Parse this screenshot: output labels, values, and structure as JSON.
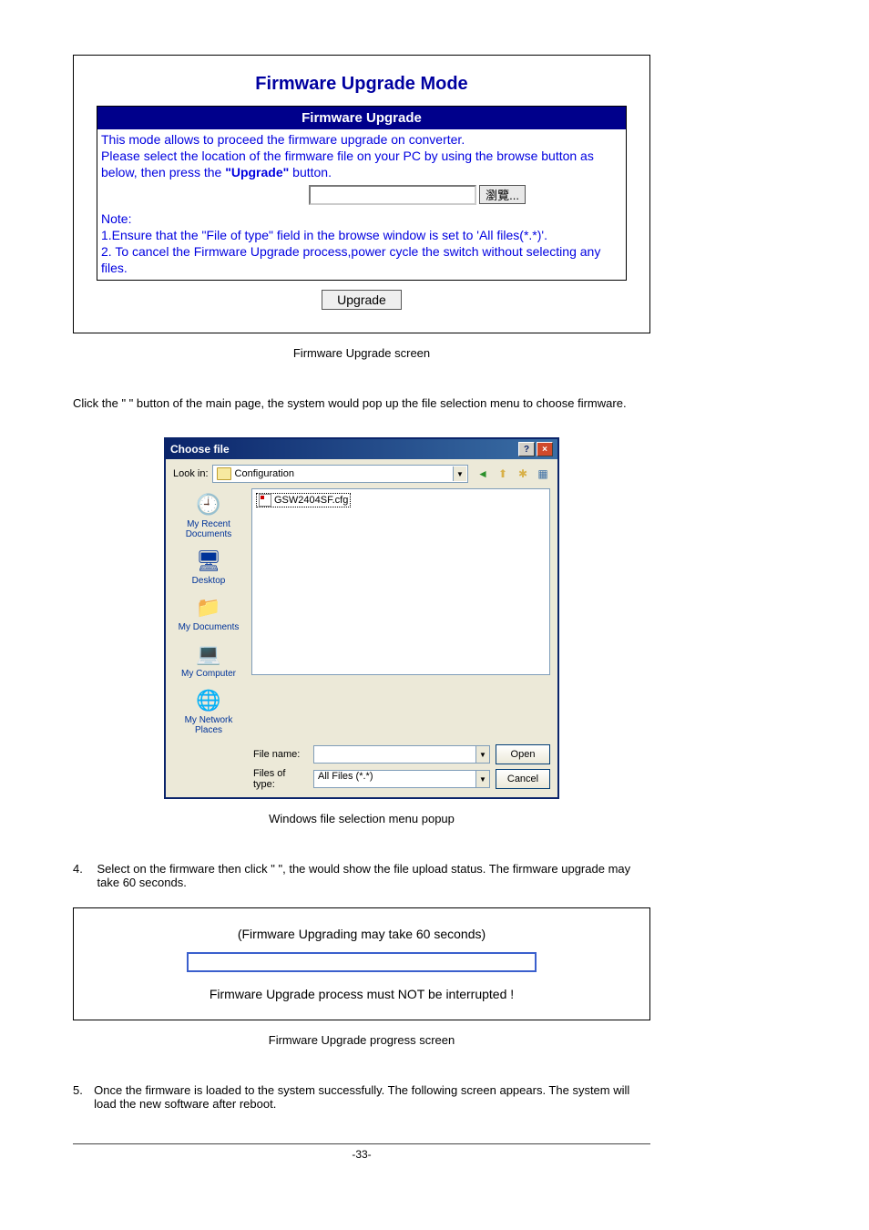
{
  "firmware_panel": {
    "title": "Firmware Upgrade Mode",
    "section_header": "Firmware Upgrade",
    "desc_line1": "This mode allows to proceed the firmware upgrade on converter.",
    "desc_line2a": "Please select the location of the firmware file on your PC by using the browse button as below, then press the ",
    "desc_upgrade_bold": "\"Upgrade\"",
    "desc_line2b": " button.",
    "browse_btn": "瀏覽...",
    "note_label": "Note:",
    "note1a": "1.Ensure that the ",
    "note1_bold": "\"File of type\"",
    "note1b": " field in the browse window is set to 'All files(*.*)'.",
    "note2": "2. To cancel the Firmware Upgrade process,power cycle the switch without selecting any files.",
    "upgrade_btn": "Upgrade"
  },
  "caption1": "Firmware Upgrade screen",
  "body1": "Click the \"            \" button of the main page, the system would pop up the file selection menu to choose firmware.",
  "dialog": {
    "title": "Choose file",
    "look_in_label": "Look in:",
    "look_in_value": "Configuration",
    "sidebar": {
      "recent": "My Recent Documents",
      "desktop": "Desktop",
      "documents": "My Documents",
      "computer": "My Computer",
      "network": "My Network Places"
    },
    "file_item": "GSW2404SF.cfg",
    "filename_label": "File name:",
    "filetype_label": "Files of type:",
    "filetype_value": "All Files (*.*)",
    "open_btn": "Open",
    "cancel_btn": "Cancel"
  },
  "caption2": "Windows file selection menu popup",
  "step4": {
    "num": "4.",
    "text": "Select on the firmware then click \"               \", the                                                         would show the file upload status. The firmware upgrade may take 60 seconds."
  },
  "progress": {
    "line1": "(Firmware Upgrading may take 60 seconds)",
    "line2": "Firmware Upgrade process must NOT be interrupted !"
  },
  "caption3": "Firmware Upgrade progress screen",
  "step5": {
    "num": "5.",
    "text": "Once the firmware is loaded to the system successfully. The following screen appears. The system will load the new software after reboot."
  },
  "page": "-33-"
}
